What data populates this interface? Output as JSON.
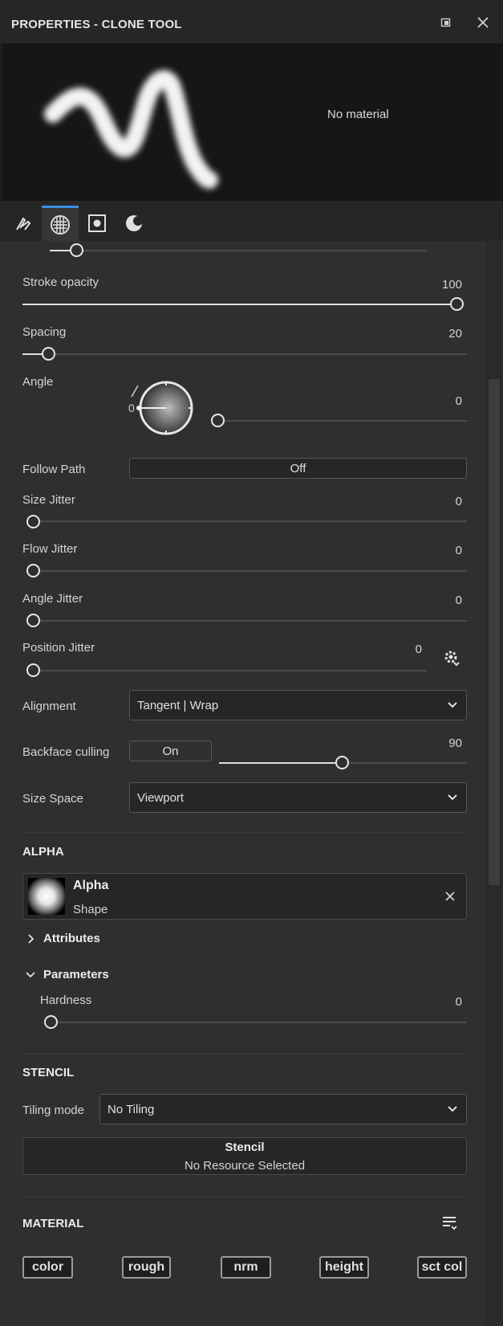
{
  "window": {
    "title": "PROPERTIES - CLONE TOOL",
    "preview_text": "No material"
  },
  "tabs": [
    {
      "icon": "brush-stroke-icon",
      "active": false
    },
    {
      "icon": "checker-sphere-icon",
      "active": true
    },
    {
      "icon": "alpha-square-icon",
      "active": false
    },
    {
      "icon": "stencil-moon-icon",
      "active": false
    }
  ],
  "brush": {
    "stroke_opacity": {
      "label": "Stroke opacity",
      "value": "100"
    },
    "spacing": {
      "label": "Spacing",
      "value": "20"
    },
    "angle": {
      "label": "Angle",
      "value": "0",
      "dial_value": "0"
    },
    "follow_path": {
      "label": "Follow Path",
      "value": "Off"
    },
    "size_jitter": {
      "label": "Size Jitter",
      "value": "0"
    },
    "flow_jitter": {
      "label": "Flow Jitter",
      "value": "0"
    },
    "angle_jitter": {
      "label": "Angle Jitter",
      "value": "0"
    },
    "position_jitter": {
      "label": "Position Jitter",
      "value": "0"
    },
    "alignment": {
      "label": "Alignment",
      "value": "Tangent | Wrap"
    },
    "backface_culling": {
      "label": "Backface culling",
      "toggle": "On",
      "value": "90"
    },
    "size_space": {
      "label": "Size Space",
      "value": "Viewport"
    }
  },
  "alpha": {
    "section_title": "ALPHA",
    "resource_name": "Alpha",
    "resource_type": "Shape",
    "attributes_label": "Attributes",
    "parameters_label": "Parameters",
    "hardness": {
      "label": "Hardness",
      "value": "0"
    }
  },
  "stencil": {
    "section_title": "STENCIL",
    "tiling_label": "Tiling mode",
    "tiling_value": "No Tiling",
    "resource_title": "Stencil",
    "resource_status": "No Resource Selected"
  },
  "material": {
    "section_title": "MATERIAL",
    "channels": [
      "color",
      "rough",
      "nrm",
      "height",
      "sct col"
    ]
  },
  "colors": {
    "accent": "#3a8fe0",
    "panel": "#2f2f2f",
    "header": "#262626",
    "preview_bg": "#161616"
  }
}
